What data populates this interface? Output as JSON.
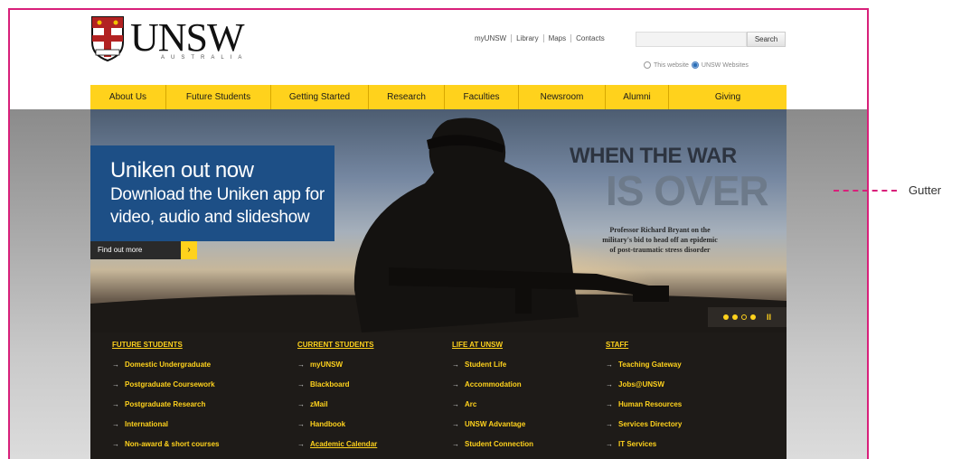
{
  "header": {
    "logo_text": "UNSW",
    "logo_subtext": "AUSTRALIA",
    "top_links": [
      "myUNSW",
      "Library",
      "Maps",
      "Contacts"
    ],
    "search": {
      "placeholder": "",
      "button_label": "Search"
    },
    "scope": {
      "option_1": "This website",
      "option_2": "UNSW Websites"
    }
  },
  "nav": {
    "items": [
      "About Us",
      "Future Students",
      "Getting Started",
      "Research",
      "Faculties",
      "Newsroom",
      "Alumni",
      "Giving"
    ]
  },
  "hero": {
    "promo_title": "Uniken out now",
    "promo_body_1": "Download the Uniken app for",
    "promo_body_2": "video, audio and slideshow",
    "cta_label": "Find out more",
    "cta_arrow": "›",
    "headline_1": "WHEN THE WAR",
    "headline_2": "IS OVER",
    "caption_1": "Professor Richard Bryant on the",
    "caption_2": "military's bid to head off an epidemic",
    "caption_3": "of post-traumatic stress disorder",
    "slider_pause": "II",
    "slider_active_index": 1
  },
  "links": {
    "columns": [
      {
        "heading": "FUTURE STUDENTS",
        "items": [
          "Domestic Undergraduate",
          "Postgraduate Coursework",
          "Postgraduate Research",
          "International",
          "Non-award & short courses"
        ]
      },
      {
        "heading": "CURRENT STUDENTS",
        "items": [
          "myUNSW",
          "Blackboard",
          "zMail",
          "Handbook",
          "Academic Calendar"
        ]
      },
      {
        "heading": "LIFE AT UNSW",
        "items": [
          "Student Life",
          "Accommodation",
          "Arc",
          "UNSW Advantage",
          "Student Connection"
        ]
      },
      {
        "heading": "STAFF",
        "items": [
          "Teaching Gateway",
          "Jobs@UNSW",
          "Human Resources",
          "Services Directory",
          "IT Services"
        ]
      }
    ],
    "arrow": "→"
  },
  "annotation": {
    "gutter_label": "Gutter",
    "frame_color": "#d8207a"
  },
  "colors": {
    "brand_yellow": "#ffd21c",
    "promo_blue": "#1d4f86",
    "footer_dark": "#1e1b18"
  }
}
